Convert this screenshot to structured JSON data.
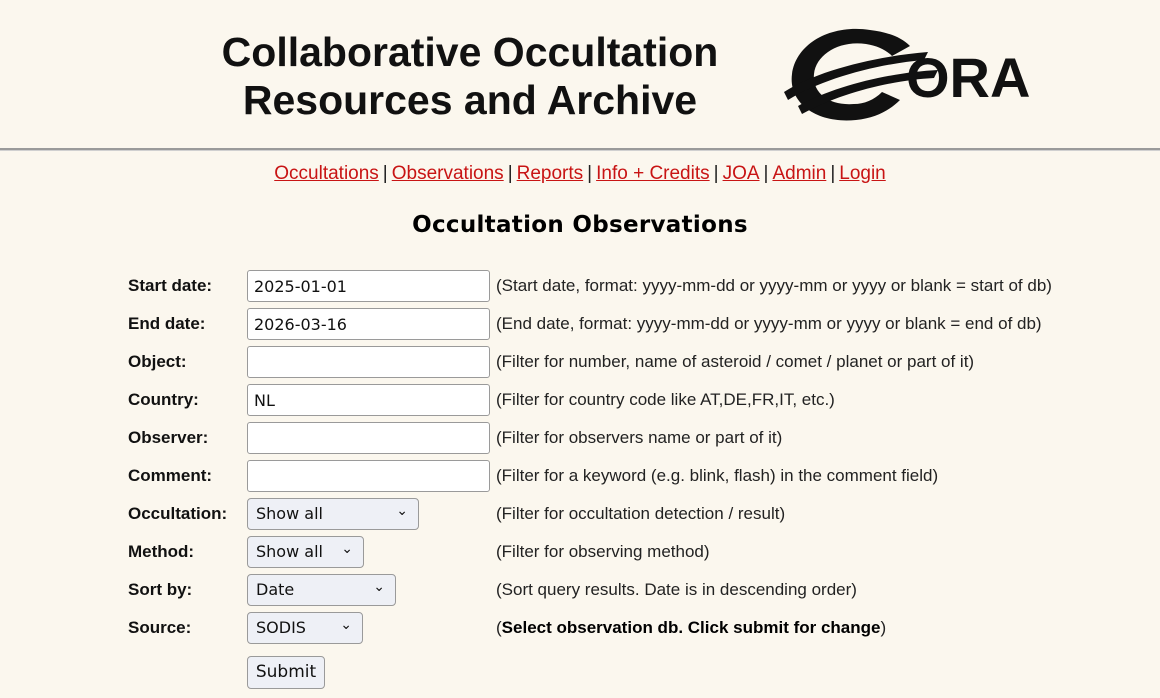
{
  "header": {
    "title_line1": "Collaborative Occultation",
    "title_line2": "Resources and Archive",
    "logo_text": "ORA"
  },
  "nav": {
    "items": [
      "Occultations",
      "Observations",
      "Reports",
      "Info + Credits",
      "JOA",
      "Admin",
      "Login"
    ],
    "separator": "|"
  },
  "page_title": "Occultation Observations",
  "form": {
    "start_date": {
      "label": "Start date:",
      "value": "2025-01-01",
      "desc": "(Start date, format: yyyy-mm-dd or yyyy-mm or yyyy or blank = start of db)"
    },
    "end_date": {
      "label": "End date:",
      "value": "2026-03-16",
      "desc": "(End date, format: yyyy-mm-dd or yyyy-mm or yyyy or blank = end of db)"
    },
    "object": {
      "label": "Object:",
      "value": "",
      "desc": "(Filter for number, name of asteroid / comet / planet or part of it)"
    },
    "country": {
      "label": "Country:",
      "value": "NL",
      "desc": "(Filter for country code like AT,DE,FR,IT, etc.)"
    },
    "observer": {
      "label": "Observer:",
      "value": "",
      "desc": "(Filter for observers name or part of it)"
    },
    "comment": {
      "label": "Comment:",
      "value": "",
      "desc": "(Filter for a keyword (e.g. blink, flash) in the comment field)"
    },
    "occultation": {
      "label": "Occultation:",
      "selected": "Show all",
      "desc": "(Filter for occultation detection / result)"
    },
    "method": {
      "label": "Method:",
      "selected": "Show all",
      "desc": "(Filter for observing method)"
    },
    "sort_by": {
      "label": "Sort by:",
      "selected": "Date",
      "desc": "(Sort query results. Date is in descending order)"
    },
    "source": {
      "label": "Source:",
      "selected": "SODIS",
      "desc_open": "(",
      "desc_bold": "Select observation db. Click submit for change",
      "desc_close": ")"
    },
    "submit_label": "Submit"
  },
  "colors": {
    "background": "#fbf7ee",
    "link": "#c81414",
    "rule": "#9a9a9a"
  },
  "icons": {
    "select_chevron": "chevron-down-icon"
  }
}
